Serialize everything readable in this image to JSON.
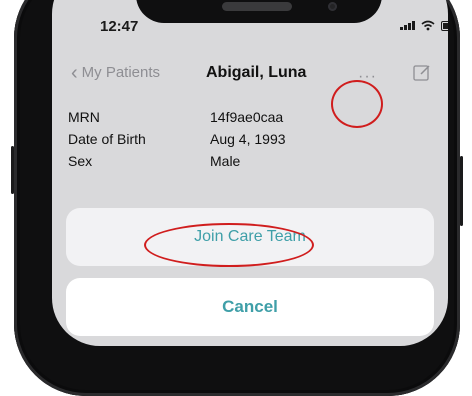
{
  "status_bar": {
    "time": "12:47"
  },
  "nav": {
    "back_label": "My Patients",
    "title": "Abigail, Luna",
    "more_label": "···"
  },
  "patient": [
    {
      "label": "MRN",
      "value": "14f9ae0caa"
    },
    {
      "label": "Date of Birth",
      "value": "Aug 4, 1993"
    },
    {
      "label": "Sex",
      "value": "Male"
    }
  ],
  "action_sheet": {
    "primary_action": "Join Care Team",
    "cancel_label": "Cancel"
  },
  "colors": {
    "accent": "#3f9fa8",
    "highlight_circle": "#d01d1d",
    "nav_gray": "#8e8e93"
  },
  "icons": {
    "back": "chevron-left-icon",
    "more": "ellipsis-icon",
    "edit": "compose-icon"
  }
}
